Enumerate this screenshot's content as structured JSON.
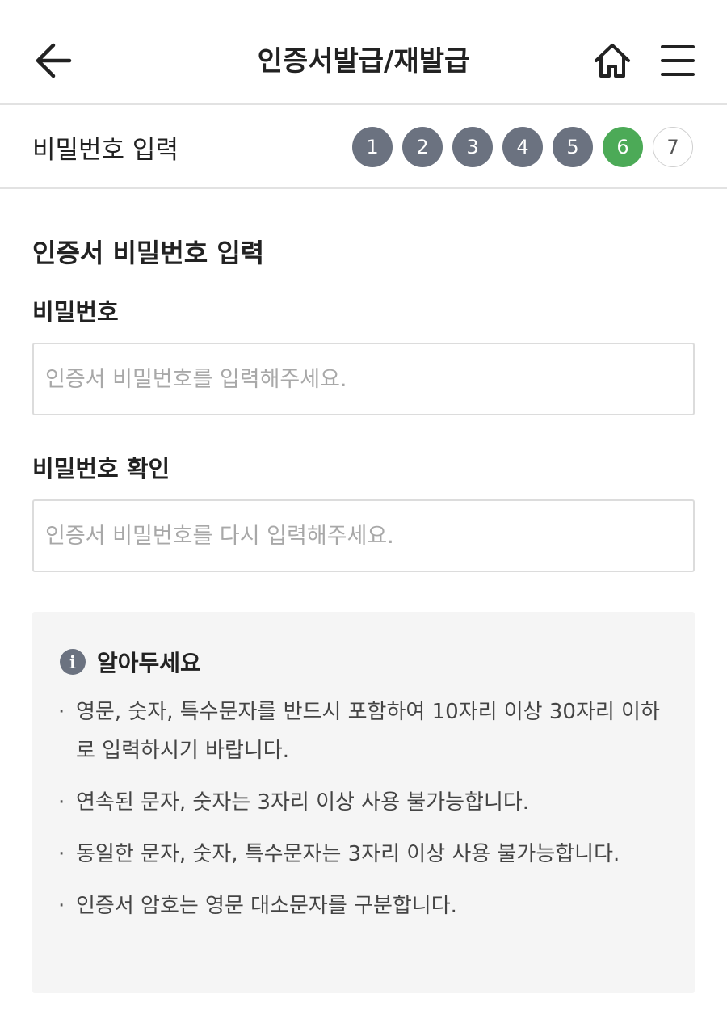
{
  "header": {
    "title": "인증서발급/재발급",
    "back_icon": "arrow-left-icon",
    "home_icon": "home-icon",
    "menu_icon": "hamburger-menu-icon"
  },
  "step_row": {
    "title": "비밀번호 입력",
    "steps": [
      "1",
      "2",
      "3",
      "4",
      "5",
      "6",
      "7"
    ],
    "current_step": 6,
    "colors": {
      "done": "#6b7280",
      "active": "#4caa57",
      "pending": "#ffffff"
    }
  },
  "form": {
    "section_title": "인증서 비밀번호 입력",
    "password": {
      "label": "비밀번호",
      "value": "",
      "placeholder": "인증서 비밀번호를 입력해주세요."
    },
    "confirm": {
      "label": "비밀번호 확인",
      "value": "",
      "placeholder": "인증서 비밀번호를 다시 입력해주세요."
    }
  },
  "notice": {
    "icon": "info-icon",
    "icon_glyph": "i",
    "title": "알아두세요",
    "items": [
      "영문, 숫자, 특수문자를 반드시 포함하여 10자리 이상 30자리 이하로 입력하시기 바랍니다.",
      "연속된 문자, 숫자는 3자리 이상 사용 불가능합니다.",
      "동일한 문자, 숫자, 특수문자는 3자리 이상 사용 불가능합니다.",
      "인증서 암호는 영문 대소문자를 구분합니다."
    ]
  }
}
